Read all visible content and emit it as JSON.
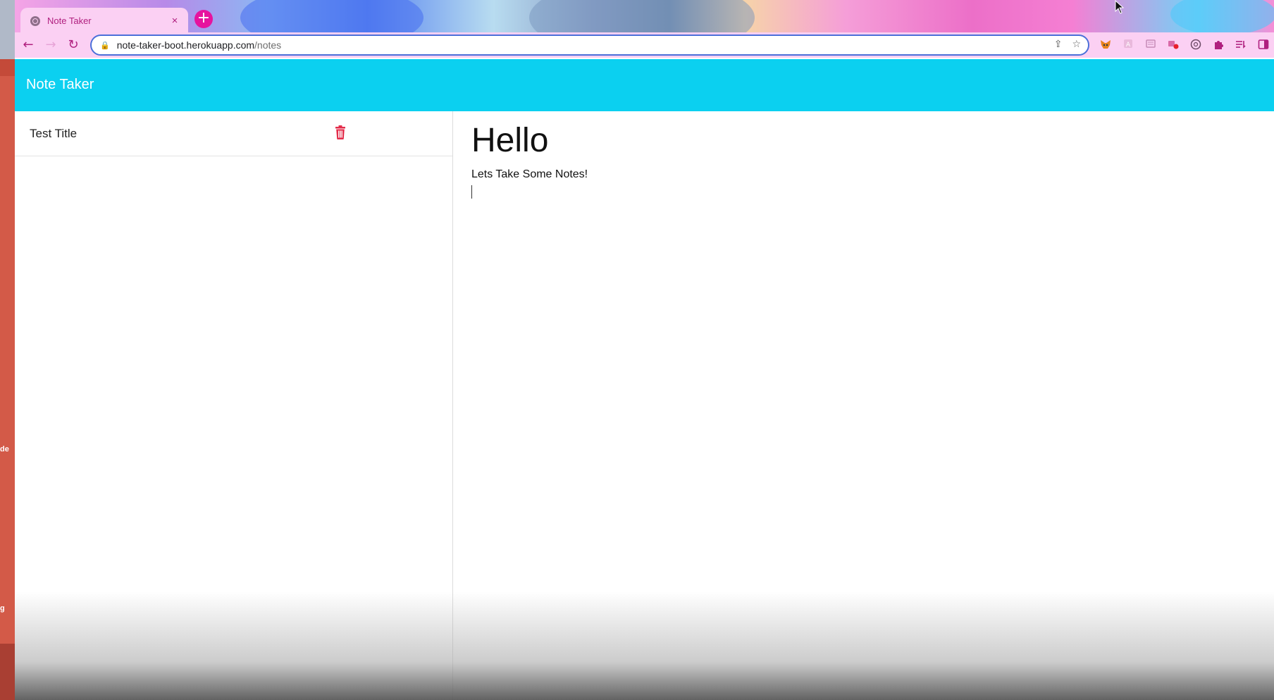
{
  "desktop": {
    "strip_text_1": "de",
    "strip_text_2": "g"
  },
  "browser": {
    "tab": {
      "title": "Note Taker",
      "close_glyph": "×",
      "favicon": "globe-icon"
    },
    "new_tab_glyph": "+",
    "nav": {
      "back_glyph": "←",
      "forward_glyph": "→",
      "reload_glyph": "↻"
    },
    "address": {
      "lock_glyph": "🔒",
      "host": "note-taker-boot.herokuapp.com",
      "path": "/notes",
      "share_glyph": "⇪",
      "star_glyph": "☆"
    },
    "extensions": [
      "metamask-icon",
      "extension-icon",
      "list-icon",
      "record-icon",
      "circle-icon",
      "puzzle-icon",
      "reading-list-icon",
      "side-panel-icon"
    ],
    "accent_color": "#b0207f",
    "tab_bar_color": "#fbd0f3"
  },
  "app": {
    "brand": "Note Taker",
    "navbar_color": "#0bd0f0",
    "notes": [
      {
        "title": "Test Title"
      }
    ],
    "delete_color": "#e32d4b",
    "active_note": {
      "title": "Hello",
      "text": "Lets Take Some Notes!"
    }
  }
}
